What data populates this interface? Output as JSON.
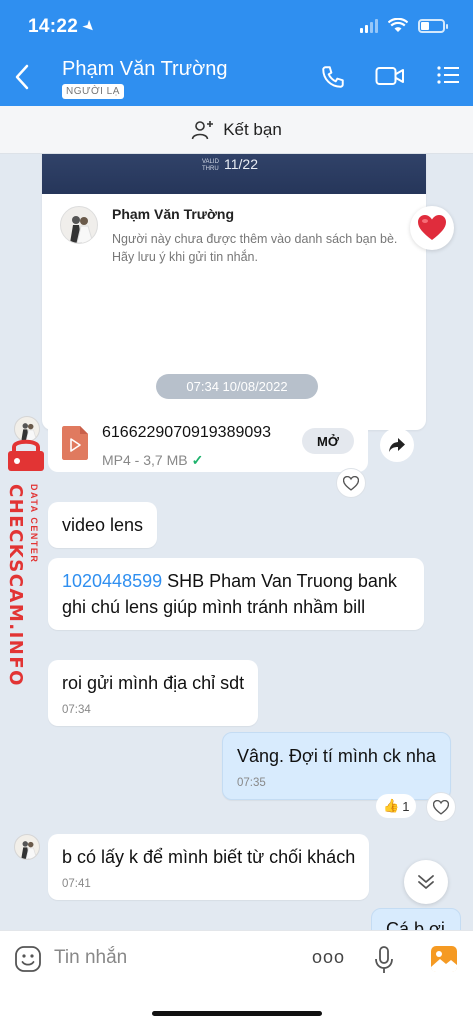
{
  "status": {
    "time": "14:22"
  },
  "header": {
    "contact_name": "Phạm Văn Trường",
    "badge": "NGƯỜI LẠ"
  },
  "add_friend": {
    "label": "Kết bạn"
  },
  "card": {
    "valid_line1": "VALID",
    "valid_line2": "THRU",
    "expiry": "11/22",
    "name": "Phạm Văn Trường",
    "note": "Người này chưa được thêm vào danh sách bạn bè. Hãy lưu ý khi gửi tin nhắn."
  },
  "date_separator": "07:34 10/08/2022",
  "file_message": {
    "name": "6166229070919389093",
    "meta": "MP4 - 3,7 MB",
    "open_label": "MỞ"
  },
  "messages": [
    {
      "text": "video lens"
    },
    {
      "link": "1020448599",
      "text": " SHB Pham Van Truong bank ghi chú lens giúp mình tránh nhầm bill"
    },
    {
      "text": "roi gửi mình địa chỉ sdt",
      "time": "07:34"
    },
    {
      "text": "Vâng. Đợi tí mình ck nha",
      "time": "07:35"
    },
    {
      "text": "b có lấy k để mình biết từ chối khách",
      "time": "07:41"
    }
  ],
  "reaction": {
    "count": "1"
  },
  "peek_message": "Cá b ơi",
  "watermark": {
    "main": "CHECKSCAM.INFO",
    "sub": "DATA CENTER"
  },
  "input": {
    "placeholder": "Tin nhắn",
    "more": "ooo"
  },
  "colors": {
    "header": "#2f8ff0",
    "outgoing_bubble": "#d8ebfd",
    "watermark": "#e23434"
  }
}
